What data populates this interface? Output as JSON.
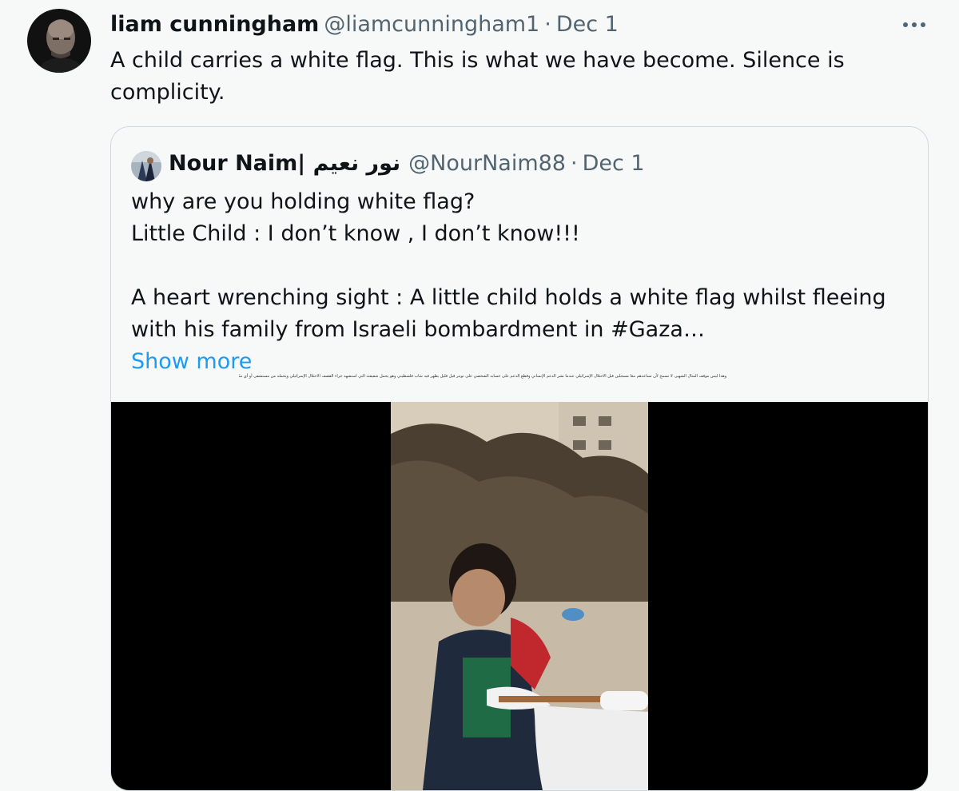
{
  "tweet": {
    "author_name": "liam cunningham",
    "author_handle": "@liamcunningham1",
    "separator": "·",
    "date": "Dec 1",
    "text": "A child carries a white flag. This is what we have become. Silence is complicity.",
    "more_icon": "more-horizontal-icon"
  },
  "quote": {
    "author_name": "Nour Naim| نور نعيم",
    "author_handle": "@NourNaim88",
    "separator": "·",
    "date": "Dec 1",
    "lines": [
      "why are you holding white flag?",
      "Little Child : I don’t know , I don’t know!!!",
      "",
      "A heart wrenching sight : A little child holds a white flag whilst fleeing",
      "with his family from Israeli bombardment in #Gaza…"
    ],
    "show_more": "Show more",
    "arabic_caption": "وهذا ليس موقف المثال الشهير، لا تسمح لأن تساعدهم معا مسجلين قبل الاحتلال الإسرائيلي عندما نشر الدعم الإنساني وقطع الدعم على حسابه الشخصي على تويتر قبل قليل يظهر فيه شاب فلسطيني وهو يحمل شقيقته التي استشهد جراء القصف الاحتلال الإسرائيلي ويحمله من مستشفى أو أي مكان آخر أمنا أو جثة"
  },
  "colors": {
    "text_primary": "#0f1419",
    "text_secondary": "#536471",
    "link": "#1d9bf0",
    "border": "#cfd9de",
    "background": "#f7f9f9",
    "media_bg": "#000000"
  }
}
